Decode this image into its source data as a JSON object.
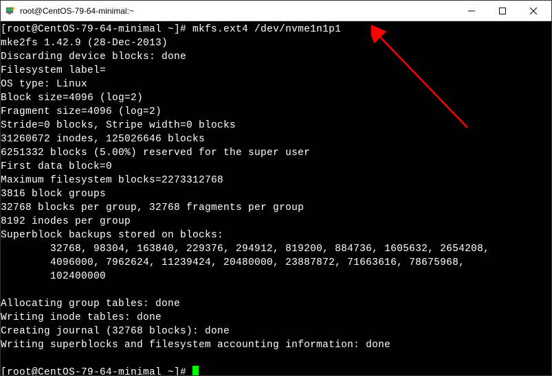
{
  "titlebar": {
    "title": "root@CentOS-79-64-minimal:~"
  },
  "terminal": {
    "prompt1": "[root@CentOS-79-64-minimal ~]# ",
    "command1": "mkfs.ext4 /dev/nvme1n1p1",
    "lines": [
      "mke2fs 1.42.9 (28-Dec-2013)",
      "Discarding device blocks: done",
      "Filesystem label=",
      "OS type: Linux",
      "Block size=4096 (log=2)",
      "Fragment size=4096 (log=2)",
      "Stride=0 blocks, Stripe width=0 blocks",
      "31260672 inodes, 125026646 blocks",
      "6251332 blocks (5.00%) reserved for the super user",
      "First data block=0",
      "Maximum filesystem blocks=2273312768",
      "3816 block groups",
      "32768 blocks per group, 32768 fragments per group",
      "8192 inodes per group",
      "Superblock backups stored on blocks:",
      "        32768, 98304, 163840, 229376, 294912, 819200, 884736, 1605632, 2654208,",
      "        4096000, 7962624, 11239424, 20480000, 23887872, 71663616, 78675968,",
      "        102400000",
      "",
      "Allocating group tables: done",
      "Writing inode tables: done",
      "Creating journal (32768 blocks): done",
      "Writing superblocks and filesystem accounting information: done",
      ""
    ],
    "prompt2": "[root@CentOS-79-64-minimal ~]# "
  }
}
